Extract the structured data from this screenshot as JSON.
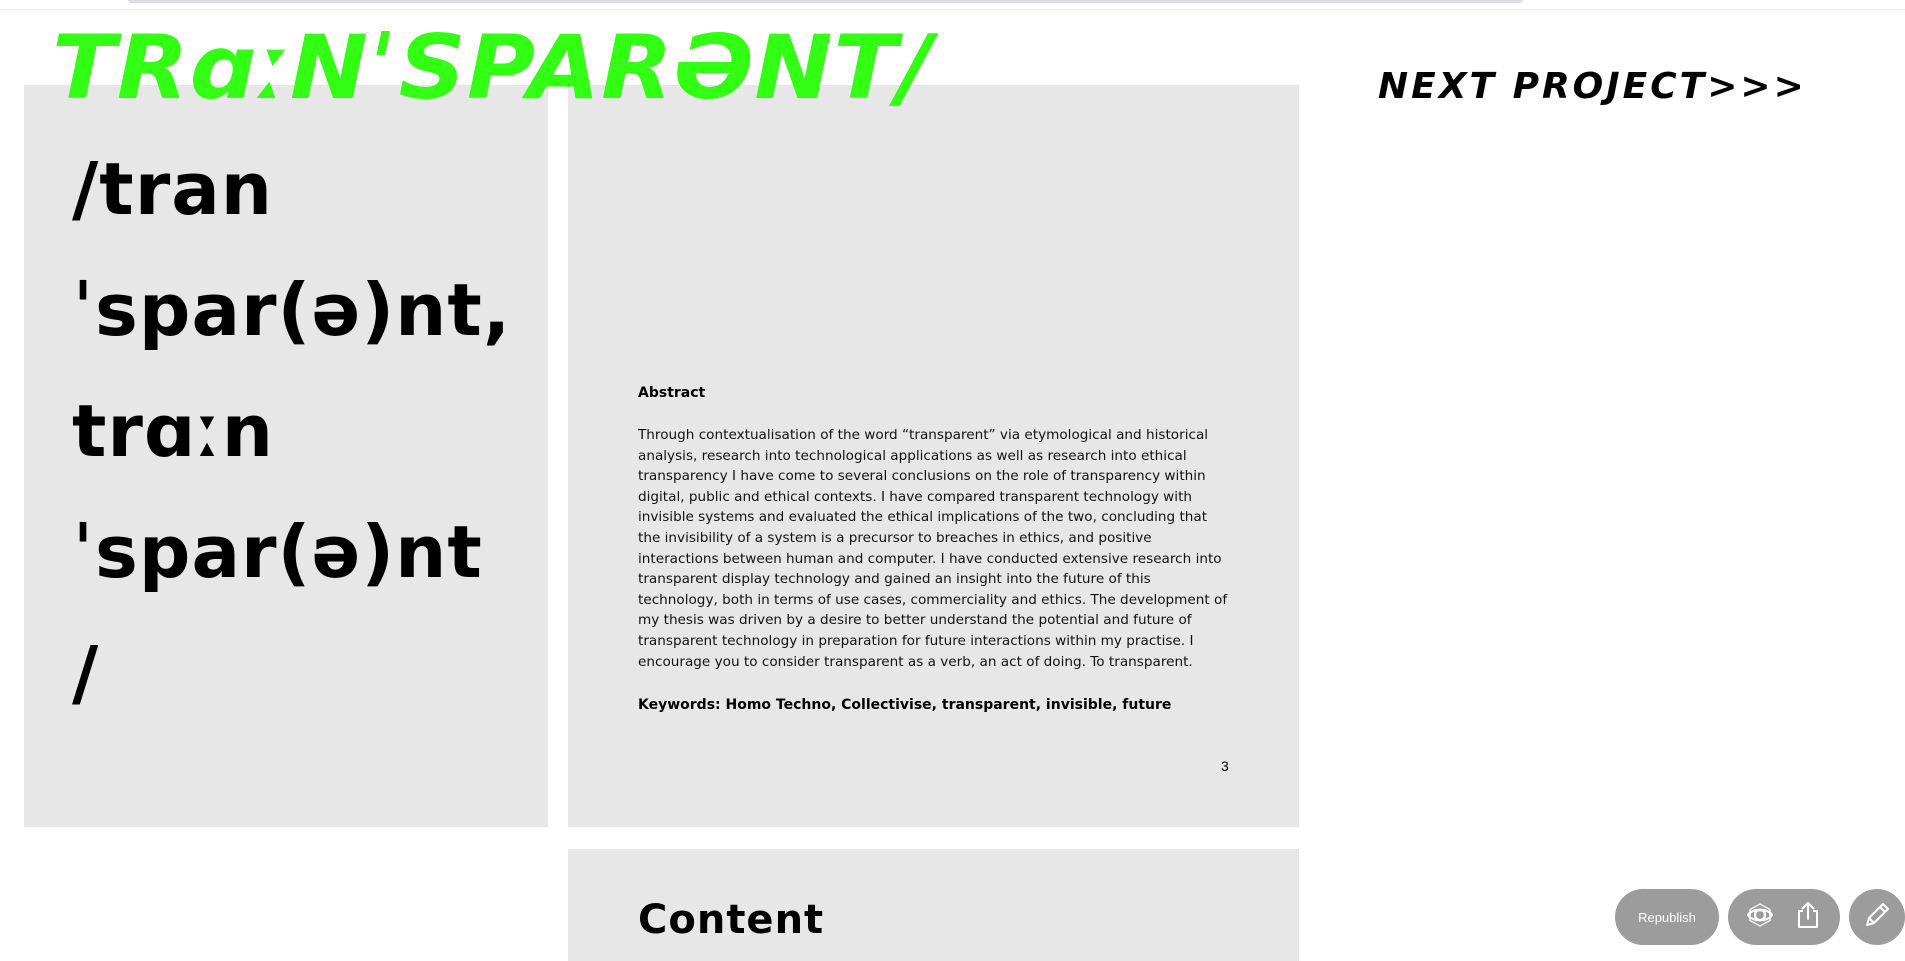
{
  "header": {
    "title": "TRɑːNˈSPARƏNT/",
    "next_project_link": "NEXT PROJECT>>>"
  },
  "phonetic_panel": {
    "lines": [
      "/tran",
      "ˈspar(ə)nt,",
      "trɑːn",
      "ˈspar(ə)nt",
      "/"
    ]
  },
  "abstract_page": {
    "heading": "Abstract",
    "body": "Through contextualisation of the word “transparent” via etymological and historical analysis, research into technological applications as well as research into ethical transparency I have come to several conclusions on the role of transparency within digital, public and ethical contexts. I have compared transparent technology with invisible systems and evaluated the ethical implications of the two, concluding that the invisibility of a system is a precursor to breaches in ethics, and positive interactions between human and computer. I have conducted extensive research into transparent display technology and gained an insight into the future of this technology, both in terms of use cases, commerciality and ethics. The development of my thesis was driven by a desire to better understand the potential and future of transparent technology in preparation for future interactions within my practise. I encourage you to consider transparent as a verb, an act of doing. To transparent.",
    "keywords": "Keywords: Homo Techno, Collectivise, transparent, invisible, future",
    "page_number": "3"
  },
  "content_page": {
    "heading": "Content"
  },
  "toolbar": {
    "republish_label": "Republish",
    "icons": [
      "eye-icon",
      "share-icon",
      "pencil-icon"
    ]
  },
  "colors": {
    "title_green": "#33ff14",
    "panel_gray": "#e7e7e7",
    "button_gray": "#9c9c9c"
  }
}
